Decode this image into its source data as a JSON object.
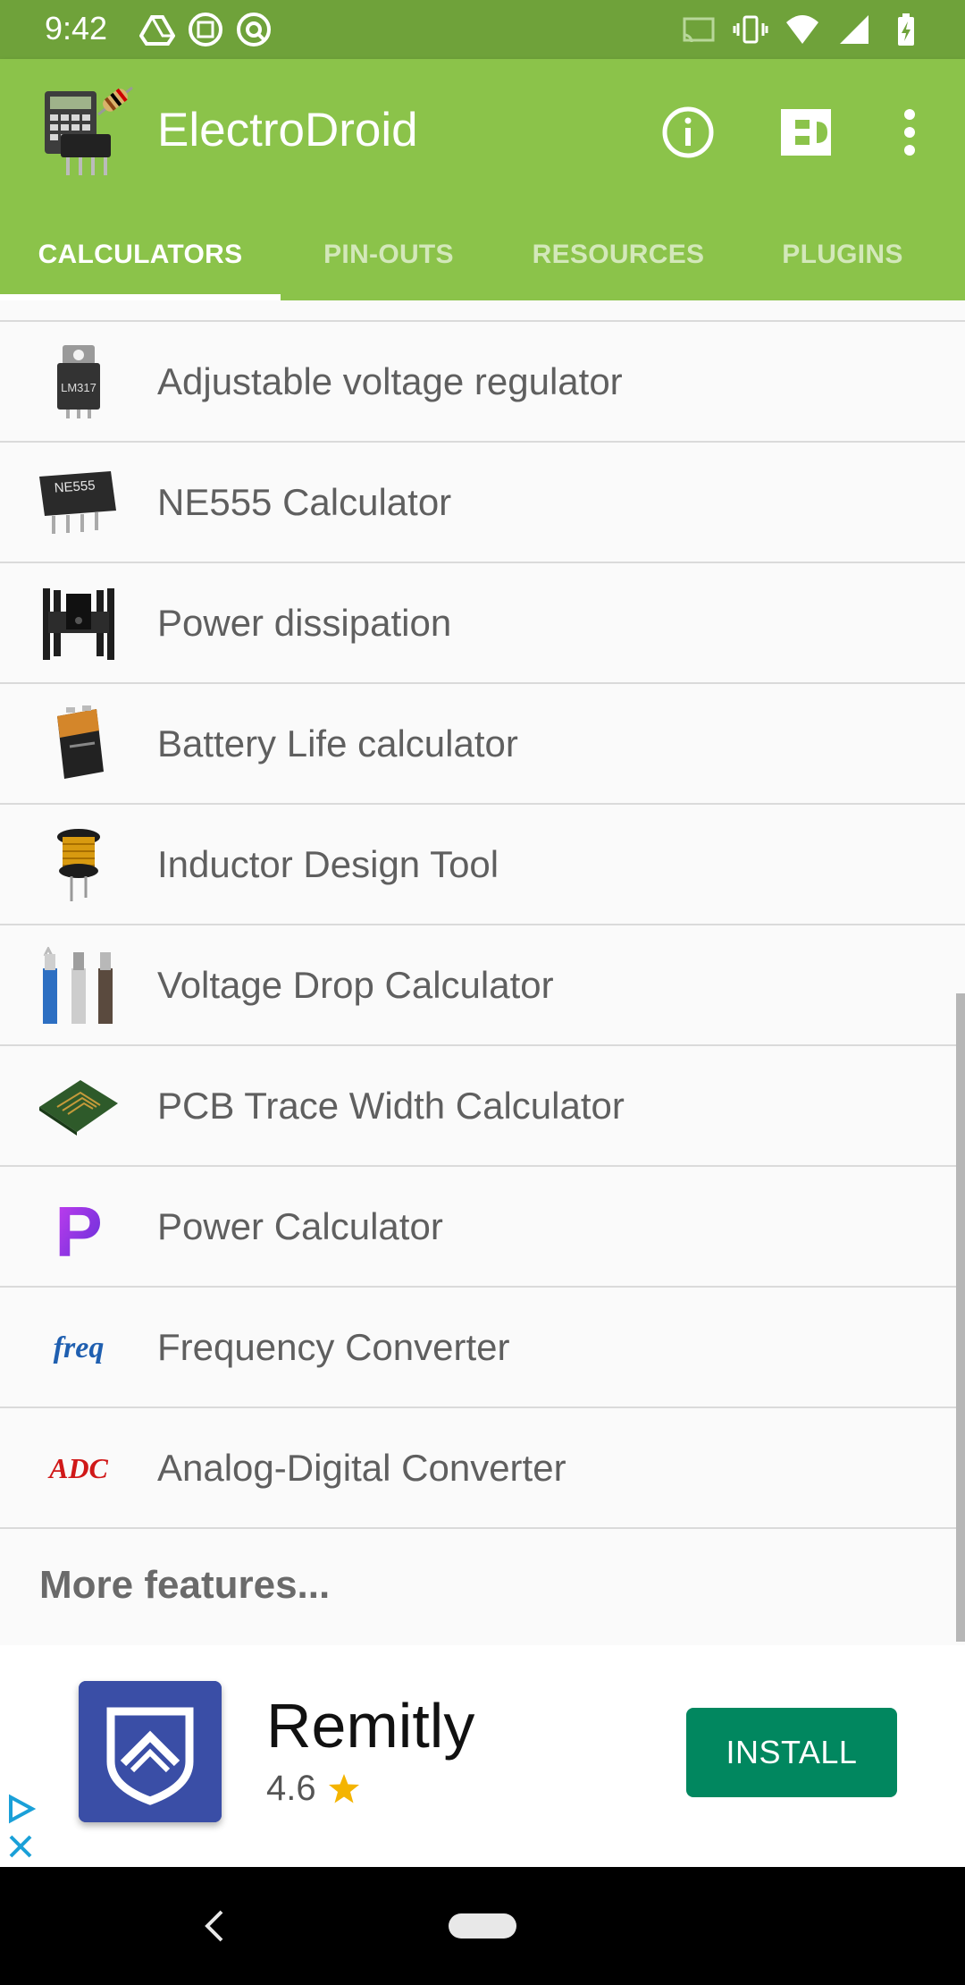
{
  "status_bar": {
    "time": "9:42",
    "left_icons": [
      "drive-icon",
      "screenshot-icon",
      "vpn-icon"
    ],
    "right_icons": [
      "cast-icon",
      "vibrate-icon",
      "wifi-icon",
      "signal-icon",
      "battery-charging-icon"
    ]
  },
  "app_bar": {
    "title": "ElectroDroid",
    "actions": [
      "info-icon",
      "plugin-icon",
      "more-vert-icon"
    ],
    "color": "#8bc34a"
  },
  "tabs": [
    {
      "label": "CALCULATORS",
      "active": true
    },
    {
      "label": "PIN-OUTS",
      "active": false
    },
    {
      "label": "RESOURCES",
      "active": false
    },
    {
      "label": "PLUGINS",
      "active": false
    }
  ],
  "list": {
    "items": [
      {
        "label": "Adjustable voltage regulator",
        "icon": "lm317-regulator-icon",
        "icon_text": "LM317"
      },
      {
        "label": "NE555 Calculator",
        "icon": "ne555-chip-icon",
        "icon_text": "NE555"
      },
      {
        "label": "Power dissipation",
        "icon": "heatsink-icon"
      },
      {
        "label": "Battery Life calculator",
        "icon": "battery-icon"
      },
      {
        "label": "Inductor Design Tool",
        "icon": "inductor-icon"
      },
      {
        "label": "Voltage Drop Calculator",
        "icon": "wires-icon"
      },
      {
        "label": "PCB Trace Width Calculator",
        "icon": "pcb-icon"
      },
      {
        "label": "Power Calculator",
        "icon": "power-p-icon",
        "icon_text": "P"
      },
      {
        "label": "Frequency Converter",
        "icon": "freq-icon",
        "icon_text": "freq"
      },
      {
        "label": "Analog-Digital Converter",
        "icon": "adc-icon",
        "icon_text": "ADC"
      }
    ],
    "more_label": "More features..."
  },
  "ad": {
    "app_name": "Remitly",
    "rating": "4.6",
    "install_label": "INSTALL",
    "install_color": "#01875f"
  }
}
